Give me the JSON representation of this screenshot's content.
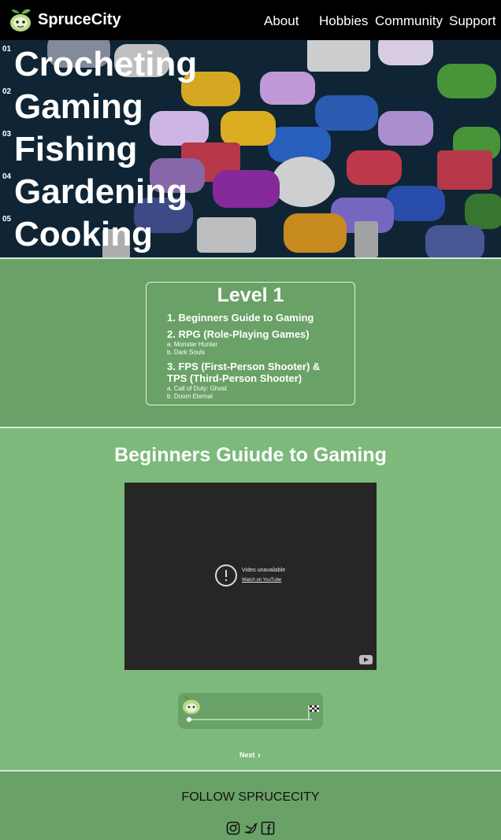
{
  "nav": {
    "brand": "SpruceCity",
    "links": [
      "About",
      "Hobbies",
      "Community",
      "Support"
    ]
  },
  "hero": {
    "items": [
      {
        "num": "01",
        "name": "Crocheting"
      },
      {
        "num": "02",
        "name": "Gaming"
      },
      {
        "num": "03",
        "name": "Fishing"
      },
      {
        "num": "04",
        "name": "Gardening"
      },
      {
        "num": "05",
        "name": "Cooking"
      }
    ]
  },
  "level": {
    "title": "Level 1",
    "item1": "1. Beginners Guide to Gaming",
    "item2": "2. RPG (Role-Playing Games)",
    "item2_subs": [
      "a. Monster Hunter",
      "b. Dark Souls"
    ],
    "item3_line1": "3. FPS (First-Person Shooter) &",
    "item3_line2": "TPS (Third-Person Shooter)",
    "item3_subs": [
      "a. Call of Duty: Ghost",
      "b. Doom Eternal"
    ]
  },
  "video": {
    "section_title": "Beginners Guiude to Gaming",
    "unavailable_text": "Video unavailable",
    "watch_link": "Watch on YouTube"
  },
  "progress": {
    "value": 0
  },
  "pager": {
    "next_label": "Next"
  },
  "footer": {
    "follow_label": "FOLLOW SPRUCECITY"
  },
  "icons": {
    "instagram": "instagram-icon",
    "twitter": "twitter-icon",
    "facebook": "facebook-icon"
  },
  "colors": {
    "nav_bg": "#000000",
    "level_bg": "#6aa167",
    "video_bg": "#7cb97b"
  }
}
